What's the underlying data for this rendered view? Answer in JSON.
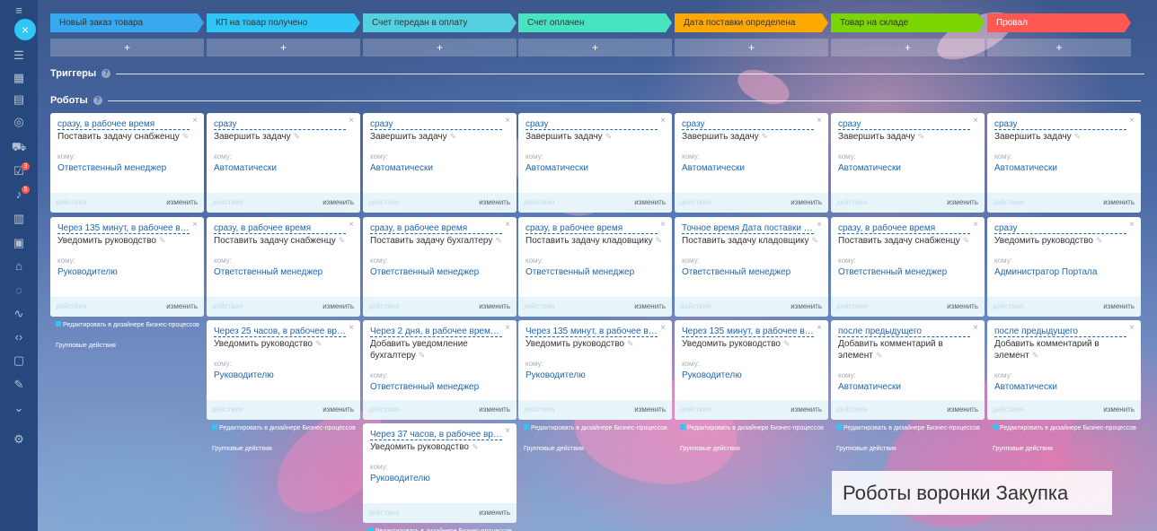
{
  "stages": [
    {
      "label": "Новый заказ товара",
      "color": "#39a8ef"
    },
    {
      "label": "КП на товар получено",
      "color": "#2fc6f6"
    },
    {
      "label": "Счет передан в оплату",
      "color": "#55d0e0"
    },
    {
      "label": "Счет оплачен",
      "color": "#47e4c2"
    },
    {
      "label": "Дата поставки определена",
      "color": "#ffa900"
    },
    {
      "label": "Товар на складе",
      "color": "#7bd500"
    },
    {
      "label": "Провал",
      "color": "#ff5752"
    }
  ],
  "add_label": "+",
  "sections": {
    "triggers": "Триггеры",
    "robots": "Роботы",
    "help_icon": "?"
  },
  "labels": {
    "to": "кому:",
    "actions": "действия",
    "change": "изменить",
    "close": "×"
  },
  "footnote": {
    "edit": "Редактировать в дизайнере Бизнес-процессов",
    "group": "Групповые действия"
  },
  "caption": "Роботы воронки Закупка",
  "columns": [
    {
      "robots": [
        {
          "cond": "сразу, в рабочее время",
          "title": "Поставить задачу снабженцу",
          "to": "Ответственный менеджер"
        },
        {
          "cond": "Через 135 минут, в рабочее время",
          "title": "Уведомить руководство",
          "to": "Руководителю"
        }
      ]
    },
    {
      "robots": [
        {
          "cond": "сразу",
          "title": "Завершить задачу",
          "to": "Автоматически"
        },
        {
          "cond": "сразу, в рабочее время",
          "title": "Поставить задачу снабженцу",
          "to": "Ответственный менеджер"
        },
        {
          "cond": "Через 25 часов, в рабочее время, по...",
          "title": "Уведомить руководство",
          "to": "Руководителю"
        }
      ]
    },
    {
      "robots": [
        {
          "cond": "сразу",
          "title": "Завершить задачу",
          "to": "Автоматически"
        },
        {
          "cond": "сразу, в рабочее время",
          "title": "Поставить задачу бухгалтеру",
          "to": "Ответственный менеджер"
        },
        {
          "cond": "Через 2 дня, в рабочее время, после...",
          "title": "Добавить уведомление бухгалтеру",
          "to": "Ответственный менеджер"
        },
        {
          "cond": "Через 37 часов, в рабочее время, по...",
          "title": "Уведомить руководство",
          "to": "Руководителю"
        }
      ]
    },
    {
      "robots": [
        {
          "cond": "сразу",
          "title": "Завершить задачу",
          "to": "Автоматически"
        },
        {
          "cond": "сразу, в рабочее время",
          "title": "Поставить задачу кладовщику",
          "to": "Ответственный менеджер"
        },
        {
          "cond": "Через 135 минут, в рабочее время",
          "title": "Уведомить руководство",
          "to": "Руководителю"
        }
      ]
    },
    {
      "robots": [
        {
          "cond": "сразу",
          "title": "Завершить задачу",
          "to": "Автоматически"
        },
        {
          "cond": "Точное время Дата поставки тов...",
          "title": "Поставить задачу кладовщику",
          "to": "Ответственный менеджер"
        },
        {
          "cond": "Через 135 минут, в рабочее время",
          "title": "Уведомить руководство",
          "to": "Руководителю"
        }
      ]
    },
    {
      "robots": [
        {
          "cond": "сразу",
          "title": "Завершить задачу",
          "to": "Автоматически"
        },
        {
          "cond": "сразу, в рабочее время",
          "title": "Поставить задачу снабженцу",
          "to": "Ответственный менеджер"
        },
        {
          "cond": "после предыдущего",
          "title": "Добавить комментарий в элемент",
          "to": "Автоматически"
        }
      ]
    },
    {
      "robots": [
        {
          "cond": "сразу",
          "title": "Завершить задачу",
          "to": "Автоматически"
        },
        {
          "cond": "сразу",
          "title": "Уведомить руководство",
          "to": "Администратор Портала"
        },
        {
          "cond": "после предыдущего",
          "title": "Добавить комментарий в элемент",
          "to": "Автоматически"
        }
      ]
    }
  ],
  "rail": {
    "tasks_badge": "3",
    "notif_badge": "5"
  }
}
